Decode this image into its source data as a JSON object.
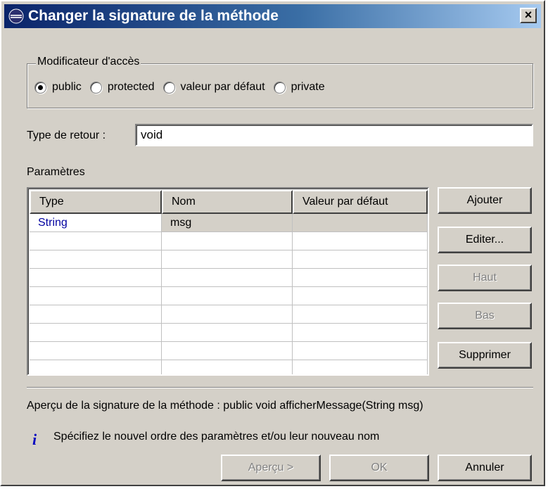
{
  "window": {
    "title": "Changer la signature de la méthode",
    "close_glyph": "×"
  },
  "access_group": {
    "legend": "Modificateur d'accès",
    "options": [
      {
        "label": "public",
        "checked": true
      },
      {
        "label": "protected",
        "checked": false
      },
      {
        "label": "valeur par défaut",
        "checked": false
      },
      {
        "label": "private",
        "checked": false
      }
    ]
  },
  "return_type": {
    "label": "Type de retour :",
    "value": "void"
  },
  "parameters": {
    "label": "Paramètres",
    "columns": [
      "Type",
      "Nom",
      "Valeur par défaut"
    ],
    "rows": [
      {
        "type": "String",
        "name": "msg",
        "default": ""
      }
    ],
    "buttons": {
      "add": "Ajouter",
      "edit": "Editer...",
      "up": "Haut",
      "down": "Bas",
      "remove": "Supprimer"
    }
  },
  "preview_text": "Aperçu de la signature de la méthode : public void afficherMessage(String msg)",
  "info_message": "Spécifiez le nouvel ordre des paramètres et/ou leur nouveau nom",
  "footer_buttons": {
    "preview": "Aperçu >",
    "ok": "OK",
    "cancel": "Annuler"
  },
  "colors": {
    "titlebar": "#0a246a",
    "dialog_bg": "#d4d0c8",
    "selected_row": "#d4d0c8",
    "type_text": "#0000a0"
  }
}
